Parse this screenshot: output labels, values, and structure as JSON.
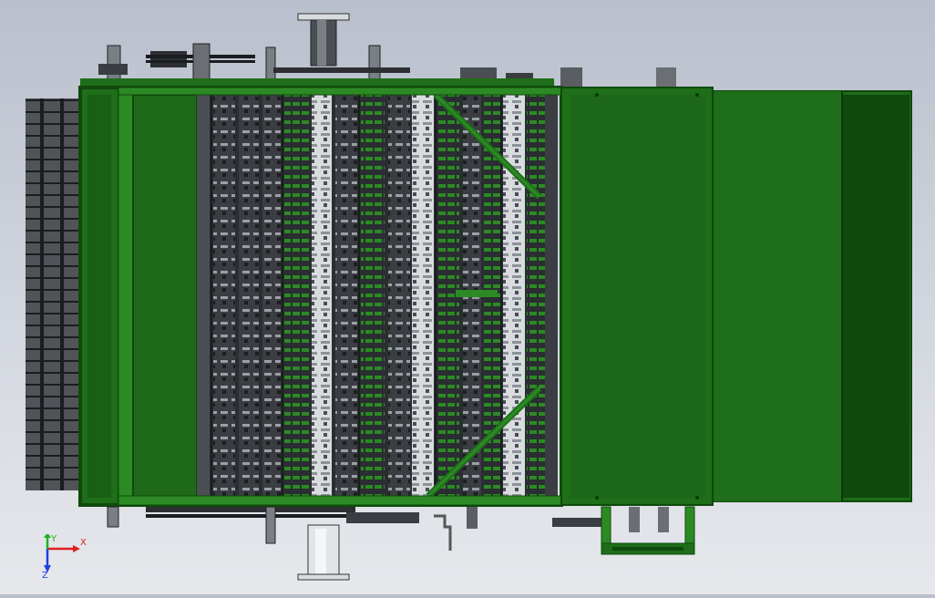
{
  "triad": {
    "x_label": "X",
    "y_label": "Y",
    "z_label": "Z",
    "x_color": "#e02020",
    "y_color": "#20b020",
    "z_color": "#2040e0"
  },
  "colors": {
    "frame_green": "#1f6e1a",
    "frame_green_dark": "#0f4a0c",
    "frame_green_light": "#2c8a24",
    "panel_green": "#1e6a18",
    "metal_gray": "#6b6f74",
    "metal_dark": "#2d2f33",
    "metal_light": "#c9ccd0"
  }
}
